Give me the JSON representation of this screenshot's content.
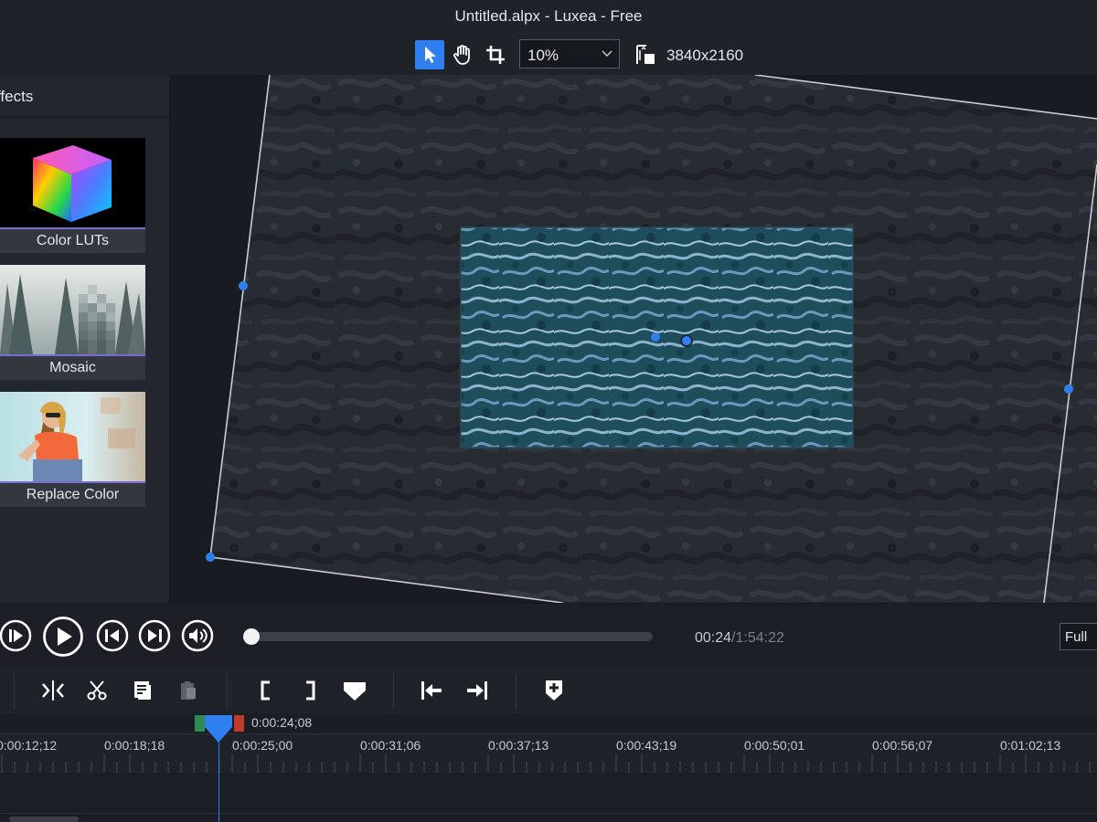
{
  "window": {
    "title": "Untitled.alpx - Luxea - Free"
  },
  "toolbar": {
    "tools": [
      {
        "name": "select-tool",
        "icon": "cursor-icon",
        "active": true
      },
      {
        "name": "pan-tool",
        "icon": "hand-icon",
        "active": false
      },
      {
        "name": "crop-tool",
        "icon": "crop-icon",
        "active": false
      }
    ],
    "zoom": {
      "value": "10%"
    },
    "resolution": {
      "icon": "resize-icon",
      "text": "3840x2160"
    }
  },
  "sidebar": {
    "header": "ffects",
    "effects": [
      {
        "label": "Color LUTs",
        "thumb": "color-cube"
      },
      {
        "label": "Mosaic",
        "thumb": "foggy-forest"
      },
      {
        "label": "Replace Color",
        "thumb": "woman-portrait"
      }
    ]
  },
  "player": {
    "buttons": [
      "play-frame-icon",
      "play-icon",
      "skip-previous-icon",
      "skip-next-icon",
      "volume-icon"
    ],
    "progress": 0.0,
    "time": {
      "current": "00:24",
      "total": "/1:54:22"
    },
    "quality": "Full"
  },
  "edit_toolbar": {
    "buttons": [
      "split-icon",
      "cut-icon",
      "copy-icon",
      "paste-icon",
      "mark-in-icon",
      "mark-out-icon",
      "marker-icon",
      "go-to-start-icon",
      "go-to-end-icon",
      "add-marker-icon"
    ]
  },
  "timeline": {
    "playhead_time": "0:00:24;08",
    "ruler_labels": [
      "0:00:12;12",
      "0:00:18;18",
      "0:00:25;00",
      "0:00:31;06",
      "0:00:37;13",
      "0:00:43;19",
      "0:00:50;01",
      "0:00:56;07",
      "0:01:02;13"
    ]
  },
  "colors": {
    "accent": "#2f7ff0",
    "range_in": "#2f8a55",
    "range_out": "#c0392b"
  }
}
